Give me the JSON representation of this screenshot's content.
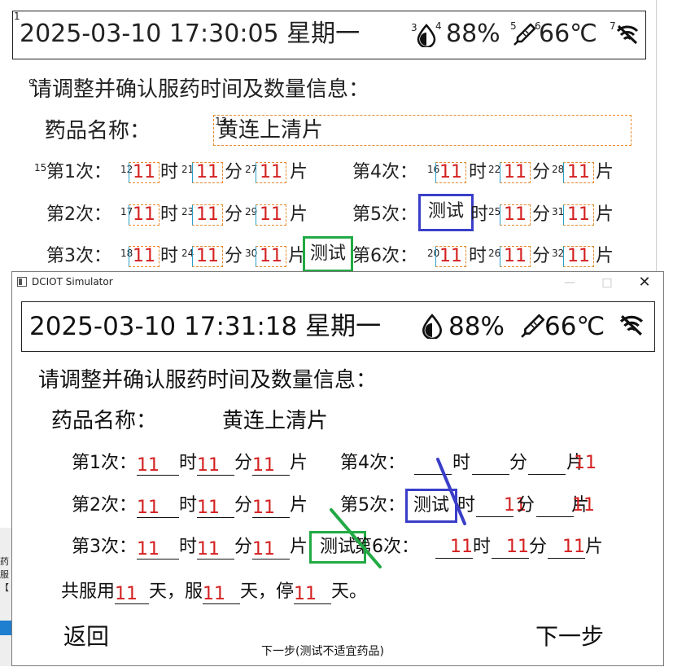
{
  "designer": {
    "datetime": "2025-03-10 17:30:05 星期一",
    "humidity": "88%",
    "temperature": "66℃",
    "prompt": "请调整并确认服药时间及数量信息：",
    "drug_label": "药品名称：",
    "drug_name": "黄连上清片",
    "rows_left": [
      {
        "label": "第1次：",
        "h": "11",
        "m": "11",
        "n": "11"
      },
      {
        "label": "第2次：",
        "h": "11",
        "m": "11",
        "n": "11"
      },
      {
        "label": "第3次：",
        "h": "11",
        "m": "11",
        "n": "11"
      }
    ],
    "rows_right": [
      {
        "label": "第4次：",
        "h": "11",
        "m": "11",
        "n": "11"
      },
      {
        "label": "第5次：",
        "h": "测试",
        "m": "11",
        "n": "11"
      },
      {
        "label": "第6次：",
        "h": "11",
        "m": "11",
        "n": "11"
      }
    ],
    "unit_hour": "时",
    "unit_min": "分",
    "unit_piece": "片",
    "test_label": "测试",
    "indices": [
      "1",
      "3",
      "4",
      "5",
      "6",
      "7",
      "9",
      "11",
      "13",
      "15",
      "12",
      "21",
      "27",
      "16",
      "22",
      "28",
      "17",
      "23",
      "29",
      "25",
      "31",
      "18",
      "24",
      "30",
      "20",
      "26",
      "32"
    ]
  },
  "strip": {
    "lines": [
      "药",
      "服",
      "【"
    ]
  },
  "window": {
    "title": "DCIOT Simulator",
    "datetime": "2025-03-10 17:31:18 星期一",
    "humidity": "88%",
    "temperature": "66℃",
    "prompt": "请调整并确认服药时间及数量信息：",
    "drug_label": "药品名称：",
    "drug_name": "黄连上清片",
    "rows_left": [
      {
        "label": "第1次：",
        "h": "11",
        "m": "11",
        "n": "11"
      },
      {
        "label": "第2次：",
        "h": "11",
        "m": "11",
        "n": "11"
      },
      {
        "label": "第3次：",
        "h": "11",
        "m": "11",
        "n": "11"
      }
    ],
    "row4": {
      "label": "第4次：",
      "n": "11"
    },
    "row5": {
      "label": "第5次：",
      "test": "测试",
      "m": "11",
      "n": "11"
    },
    "row6": {
      "label": "第6次：",
      "h": "11",
      "m": "11",
      "n": "11"
    },
    "test_label": "测试",
    "unit_hour": "时",
    "unit_min": "分",
    "unit_piece": "片",
    "total": {
      "prefix": "共服用",
      "d1": "11",
      "t1": "天，服",
      "d2": "11",
      "t2": "天，停",
      "d3": "11",
      "t3": "天。"
    },
    "back": "返回",
    "next": "下一步",
    "note": "下一步(测试不适宜药品)"
  },
  "colors": {
    "accent_red": "#d42020",
    "blue_mark": "#3a3ec8",
    "green_mark": "#22aa44"
  }
}
